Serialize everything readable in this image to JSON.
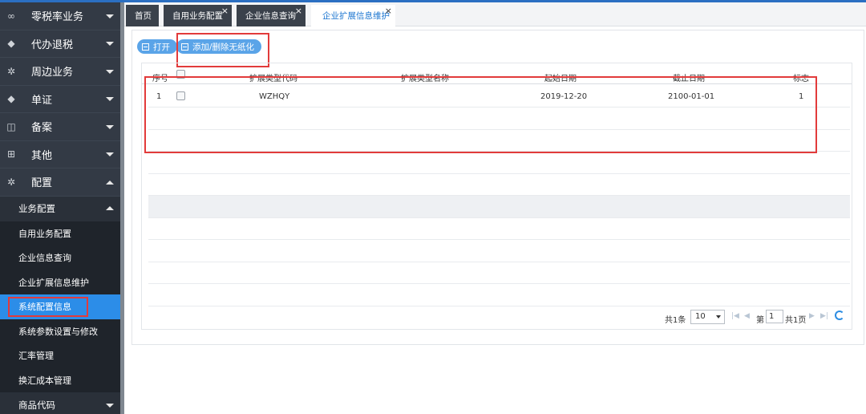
{
  "sidebar": {
    "items": [
      {
        "label": "零税率业务",
        "icon": "infinity-icon"
      },
      {
        "label": "代办退税",
        "icon": "layers-icon"
      },
      {
        "label": "周边业务",
        "icon": "gear-icon"
      },
      {
        "label": "单证",
        "icon": "layers-icon"
      },
      {
        "label": "备案",
        "icon": "book-icon"
      },
      {
        "label": "其他",
        "icon": "grid-plus-icon"
      },
      {
        "label": "配置",
        "icon": "gear-icon"
      }
    ],
    "sub_header": "业务配置",
    "sub_items": [
      "自用业务配置",
      "企业信息查询",
      "企业扩展信息维护",
      "系统配置信息",
      "系统参数设置与修改",
      "汇率管理",
      "换汇成本管理"
    ],
    "active_sub": "系统配置信息",
    "bottom_item": "商品代码"
  },
  "tabs": [
    {
      "label": "首页",
      "closable": false
    },
    {
      "label": "自用业务配置",
      "closable": true
    },
    {
      "label": "企业信息查询",
      "closable": true
    },
    {
      "label": "企业扩展信息维护",
      "closable": true,
      "active": true
    }
  ],
  "toolbar": {
    "open_label": "打开",
    "add_remove_label": "添加/删除无纸化"
  },
  "table": {
    "headers": [
      "序号",
      "",
      "扩展类型代码",
      "扩展类型名称",
      "起始日期",
      "截止日期",
      "标志"
    ],
    "rows": [
      {
        "index": "1",
        "code": "WZHQY",
        "name": "",
        "start": "2019-12-20",
        "end": "2100-01-01",
        "flag": "1"
      }
    ]
  },
  "pager": {
    "total": "共1条",
    "page_size": "10",
    "page_prefix": "第",
    "page": "1",
    "page_suffix": "共1页"
  },
  "colors": {
    "accent": "#2c8de8",
    "sidebar_bg": "#333a45",
    "highlight": "#e23b3b",
    "button": "#5aa4e8"
  }
}
